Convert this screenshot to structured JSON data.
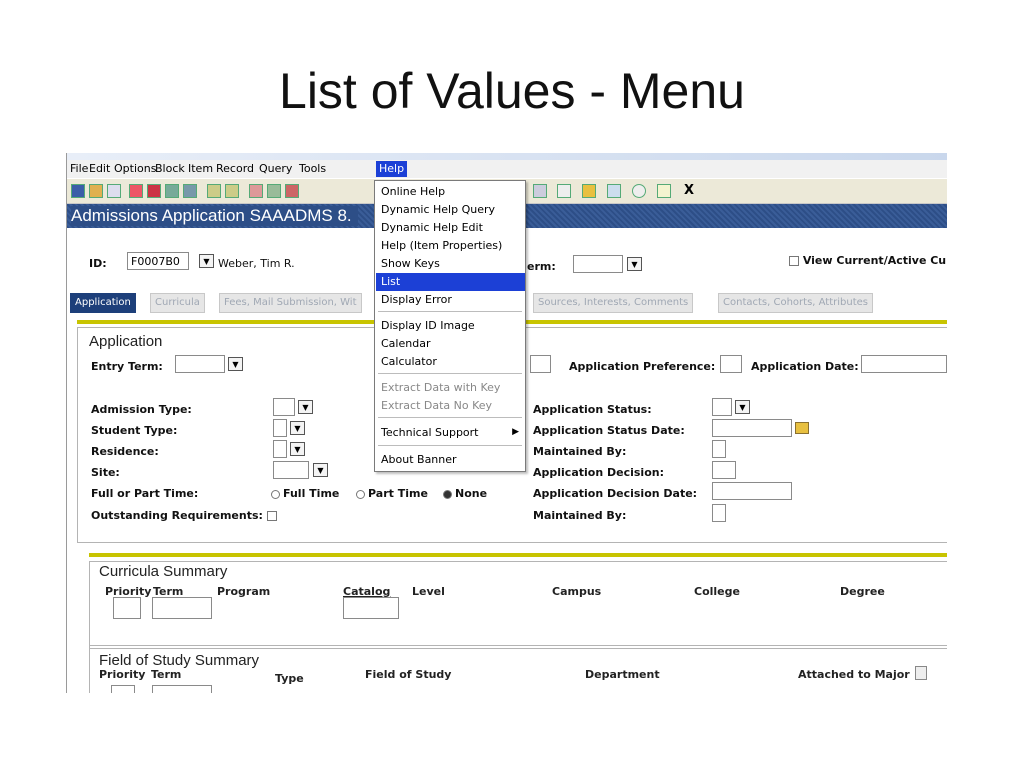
{
  "slide_title": "List of Values - Menu",
  "menubar": [
    "File",
    "Edit",
    "Options",
    "Block",
    "Item",
    "Record",
    "Query",
    "Tools",
    "Help"
  ],
  "toolbar_close": "X",
  "window_title": "Admissions Application  SAAADMS  8.",
  "key": {
    "id_label": "ID:",
    "id_value": "F0007B0",
    "name_value": "Weber, Tim R.",
    "term_label": "erm:",
    "view_current_label": "View Current/Active Cu"
  },
  "tabs": [
    "Application",
    "Curricula",
    "Fees, Mail Submission, Wit",
    "Sources, Interests, Comments",
    "Contacts, Cohorts, Attributes"
  ],
  "application": {
    "section_title": "Application",
    "entry_term_label": "Entry Term:",
    "app_preference_label": "Application Preference:",
    "app_date_label": "Application Date:",
    "admission_type_label": "Admission Type:",
    "student_type_label": "Student Type:",
    "residence_label": "Residence:",
    "site_label": "Site:",
    "full_part_label": "Full or Part Time:",
    "full_time": "Full Time",
    "part_time": "Part Time",
    "none": "None",
    "outstanding_label": "Outstanding Requirements:",
    "status_label": "Application Status:",
    "status_date_label": "Application Status Date:",
    "maintained_by_label": "Maintained By:",
    "decision_label": "Application Decision:",
    "decision_date_label": "Application Decision Date:",
    "maintained_by_label2": "Maintained By:"
  },
  "curricula_summary": {
    "title": "Curricula Summary",
    "cols": [
      "Priority",
      "Term",
      "Program",
      "Catalog",
      "Level",
      "Campus",
      "College",
      "Degree"
    ]
  },
  "field_summary": {
    "title": "Field of Study Summary",
    "cols": [
      "Priority",
      "Term",
      "Type",
      "Field of Study",
      "Department",
      "Attached to Major"
    ]
  },
  "help_menu": {
    "items": [
      "Online Help",
      "Dynamic Help Query",
      "Dynamic Help Edit",
      "Help (Item Properties)",
      "Show Keys",
      "List",
      "Display Error",
      "Display ID Image",
      "Calendar",
      "Calculator",
      "Extract Data with Key",
      "Extract Data No Key",
      "Technical Support",
      "About Banner"
    ],
    "selected": "List"
  }
}
